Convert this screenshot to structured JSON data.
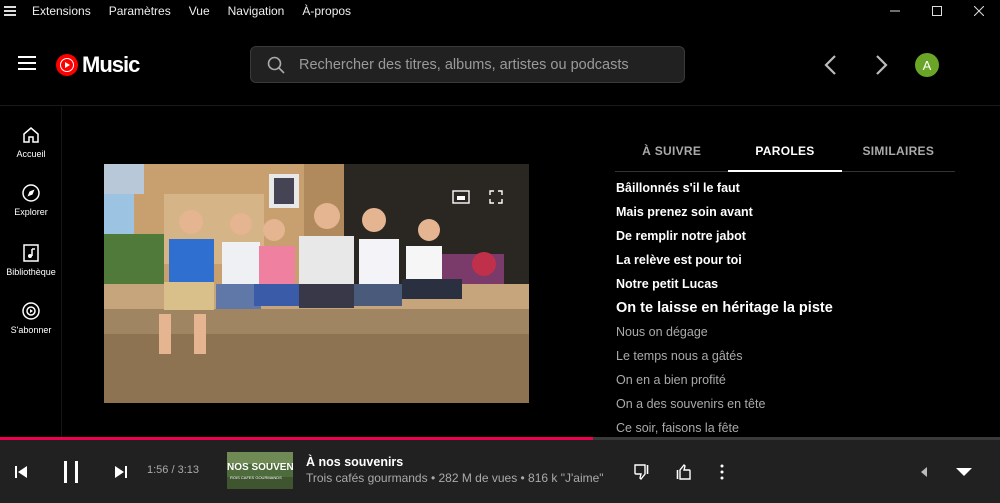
{
  "menubar": {
    "items": [
      "Extensions",
      "Paramètres",
      "Vue",
      "Navigation",
      "À-propos"
    ]
  },
  "header": {
    "logo_text": "Music",
    "search_placeholder": "Rechercher des titres, albums, artistes ou podcasts",
    "avatar_initial": "A"
  },
  "sidebar": {
    "items": [
      {
        "label": "Accueil",
        "icon": "home-icon"
      },
      {
        "label": "Explorer",
        "icon": "compass-icon"
      },
      {
        "label": "Bibliothèque",
        "icon": "library-icon"
      },
      {
        "label": "S'abonner",
        "icon": "subscribe-icon"
      }
    ]
  },
  "panel": {
    "tabs": [
      "À SUIVRE",
      "PAROLES",
      "SIMILAIRES"
    ],
    "active_tab": "PAROLES",
    "lyrics": [
      {
        "text": "Bâillonnés s'il le faut",
        "state": "past"
      },
      {
        "text": "Mais prenez soin avant",
        "state": "past"
      },
      {
        "text": "De remplir notre jabot",
        "state": "past"
      },
      {
        "text": "La relève est pour toi",
        "state": "past"
      },
      {
        "text": "Notre petit Lucas",
        "state": "past"
      },
      {
        "text": "On te laisse en héritage la piste",
        "state": "current"
      },
      {
        "text": "Nous on dégage",
        "state": "future"
      },
      {
        "text": "Le temps nous a gâtés",
        "state": "future"
      },
      {
        "text": "On en a bien profité",
        "state": "future"
      },
      {
        "text": "On a des souvenirs en tête",
        "state": "future"
      },
      {
        "text": "Ce soir, faisons la fête",
        "state": "future"
      }
    ]
  },
  "player": {
    "time": "1:56 / 3:13",
    "progress_fraction": 0.593,
    "title": "À nos souvenirs",
    "subtitle": "Trois cafés gourmands • 282 M de vues • 816 k \"J'aime\"",
    "thumb_text_1": "NOS SOUVENI",
    "thumb_text_2": "ROIS CAFES GOURMANDS"
  },
  "colors": {
    "accent": "#f0004f",
    "logo_red": "#ff0000",
    "avatar_green": "#6aa528",
    "player_bg": "#212121"
  }
}
